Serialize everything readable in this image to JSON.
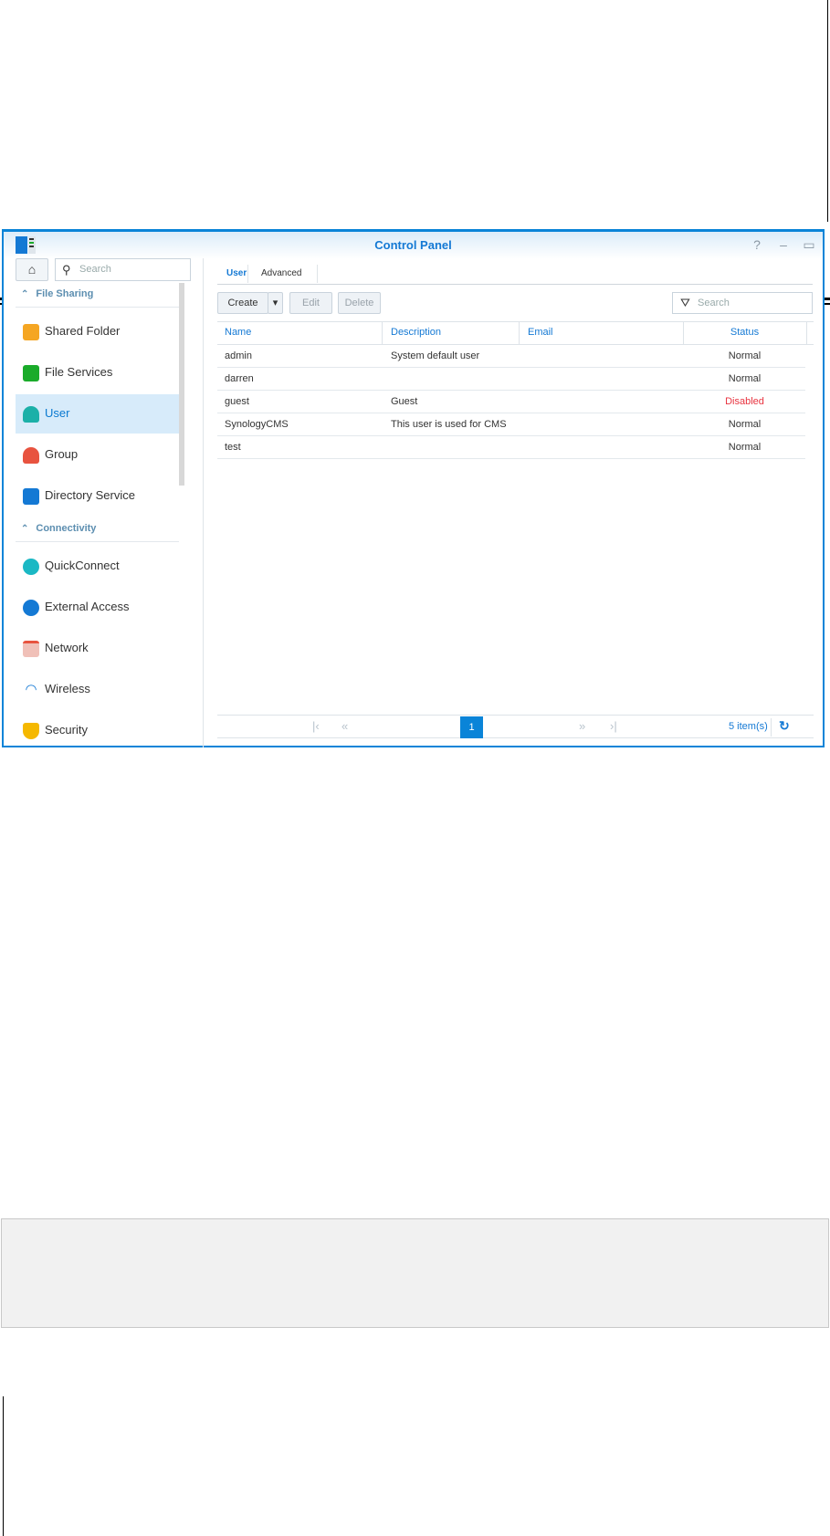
{
  "window": {
    "title": "Control Panel",
    "controls": [
      "?",
      "–",
      "▭",
      "✕"
    ]
  },
  "sidebar": {
    "search_placeholder": "Search",
    "sections": [
      {
        "label": "File Sharing",
        "items": [
          {
            "label": "Shared Folder",
            "icon": "shared-folder-icon",
            "color": "#f5a623"
          },
          {
            "label": "File Services",
            "icon": "file-services-icon",
            "color": "#1aab2a"
          },
          {
            "label": "User",
            "icon": "user-icon",
            "color": "#1bb0a8",
            "selected": true
          },
          {
            "label": "Group",
            "icon": "group-icon",
            "color": "#e8533f"
          },
          {
            "label": "Directory Service",
            "icon": "directory-service-icon",
            "color": "#1479d4"
          }
        ]
      },
      {
        "label": "Connectivity",
        "items": [
          {
            "label": "QuickConnect",
            "icon": "quickconnect-icon",
            "color": "#1bb8c4"
          },
          {
            "label": "External Access",
            "icon": "external-access-icon",
            "color": "#1479d4"
          },
          {
            "label": "Network",
            "icon": "network-icon",
            "color": "#e8533f"
          },
          {
            "label": "Wireless",
            "icon": "wireless-icon",
            "color": "#1479d4"
          },
          {
            "label": "Security",
            "icon": "security-icon",
            "color": "#f5b800"
          }
        ]
      }
    ]
  },
  "tabs": [
    {
      "label": "User",
      "active": true
    },
    {
      "label": "Advanced"
    }
  ],
  "toolbar": {
    "create": "Create",
    "edit": "Edit",
    "delete": "Delete",
    "search_placeholder": "Search"
  },
  "table": {
    "columns": [
      "Name",
      "Description",
      "Email",
      "Status"
    ],
    "rows": [
      {
        "name": "admin",
        "description": "System default user",
        "email": "",
        "status": "Normal"
      },
      {
        "name": "darren",
        "description": "",
        "email": "",
        "status": "Normal"
      },
      {
        "name": "guest",
        "description": "Guest",
        "email": "",
        "status": "Disabled"
      },
      {
        "name": "SynologyCMS",
        "description": "This user is used for CMS",
        "email": "",
        "status": "Normal"
      },
      {
        "name": "test",
        "description": "",
        "email": "",
        "status": "Normal"
      }
    ]
  },
  "pager": {
    "current_page": "1",
    "count": "5 item(s)"
  },
  "colors": {
    "accent": "#0a84d8",
    "disabled": "#e8333f"
  }
}
